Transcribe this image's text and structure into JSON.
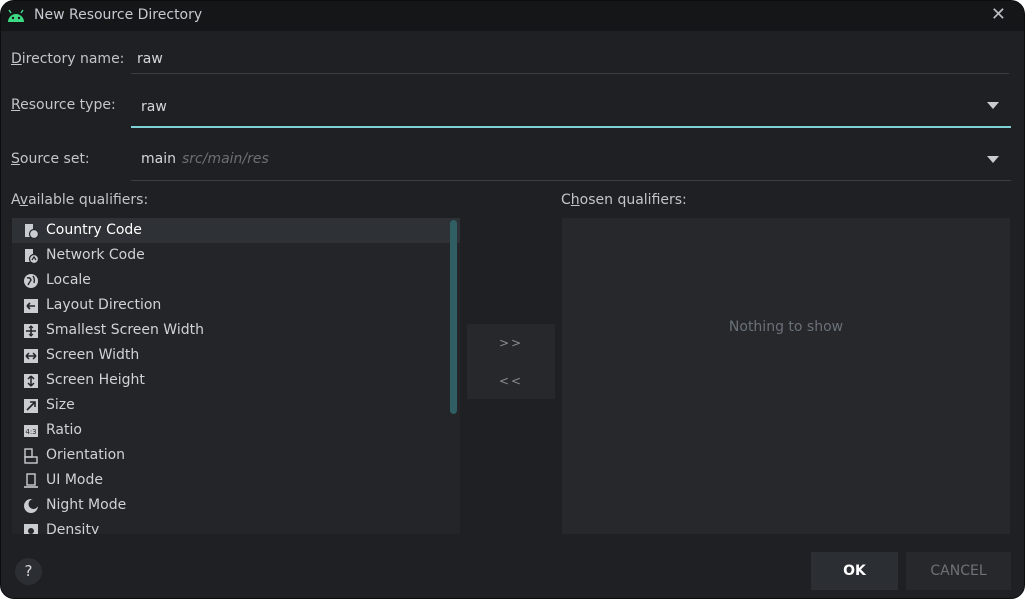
{
  "window": {
    "title": "New Resource Directory",
    "close_glyph": "✕"
  },
  "form": {
    "directory_name": {
      "label_hot": "D",
      "label_rest": "irectory name:",
      "value": "raw"
    },
    "resource_type": {
      "label_hot": "R",
      "label_rest": "esource type:",
      "value": "raw"
    },
    "source_set": {
      "label_hot": "S",
      "label_rest": "ource set:",
      "value": "main",
      "path": "src/main/res"
    }
  },
  "available": {
    "label_pre": "A",
    "label_hot": "v",
    "label_rest": "ailable qualifiers:",
    "items": [
      {
        "label": "Country Code",
        "icon": "country-code-icon"
      },
      {
        "label": "Network Code",
        "icon": "network-code-icon"
      },
      {
        "label": "Locale",
        "icon": "globe-icon"
      },
      {
        "label": "Layout Direction",
        "icon": "layout-direction-icon"
      },
      {
        "label": "Smallest Screen Width",
        "icon": "smallest-width-icon"
      },
      {
        "label": "Screen Width",
        "icon": "screen-width-icon"
      },
      {
        "label": "Screen Height",
        "icon": "screen-height-icon"
      },
      {
        "label": "Size",
        "icon": "size-icon"
      },
      {
        "label": "Ratio",
        "icon": "ratio-icon"
      },
      {
        "label": "Orientation",
        "icon": "orientation-icon"
      },
      {
        "label": "UI Mode",
        "icon": "ui-mode-icon"
      },
      {
        "label": "Night Mode",
        "icon": "night-mode-icon"
      },
      {
        "label": "Density",
        "icon": "density-icon"
      }
    ]
  },
  "chosen": {
    "label_pre": "C",
    "label_hot": "h",
    "label_rest": "osen qualifiers:",
    "empty_text": "Nothing to show"
  },
  "mover": {
    "add": ">>",
    "remove": "<<"
  },
  "footer": {
    "help": "?",
    "ok": "OK",
    "cancel": "CANCEL"
  },
  "colors": {
    "accent": "#7fd1d6",
    "android_green": "#3ddc84",
    "background": "#1e2023"
  }
}
